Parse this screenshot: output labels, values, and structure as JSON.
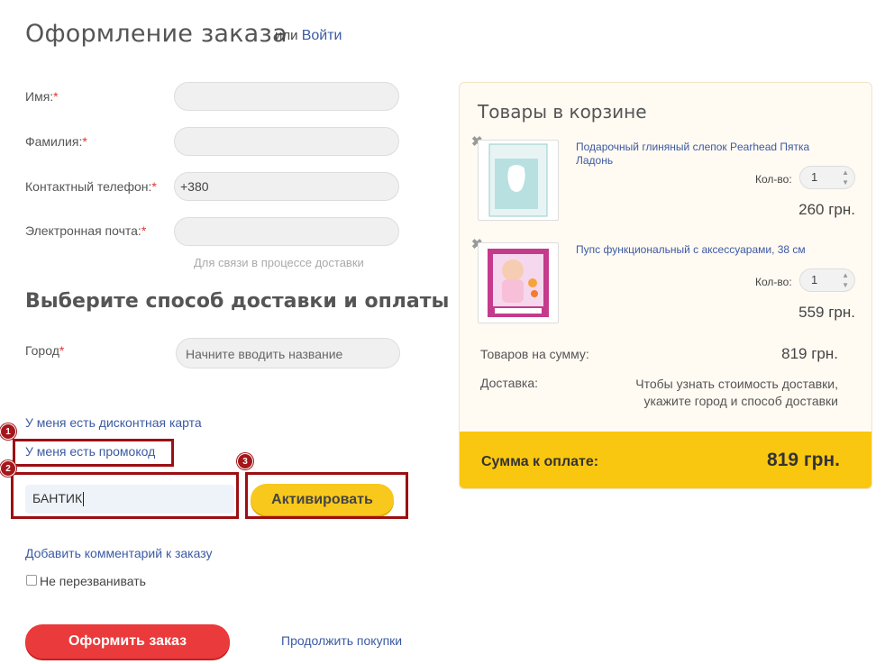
{
  "header": {
    "title": "Оформление заказа",
    "or_text": "или",
    "login_link": "Войти"
  },
  "contact_form": {
    "name_label": "Имя:",
    "lastname_label": "Фамилия:",
    "phone_label": "Контактный телефон:",
    "phone_value": "+380",
    "email_label": "Электронная почта:",
    "email_hint": "Для связи в процессе доставки",
    "required_mark": "*"
  },
  "delivery": {
    "section_title": "Выберите способ доставки и оплаты",
    "city_label": "Город",
    "city_placeholder": "Начните вводить название"
  },
  "discount": {
    "card_link": "У меня есть дисконтная карта",
    "promo_link": "У меня есть промокод",
    "promo_value": "БАНТИК",
    "activate_label": "Активировать"
  },
  "annotations": {
    "badge_1": "1",
    "badge_2": "2",
    "badge_3": "3"
  },
  "extras": {
    "comment_link": "Добавить комментарий к заказу",
    "no_call_label": "Не перезванивать"
  },
  "actions": {
    "submit_label": "Оформить заказ",
    "continue_label": "Продолжить покупки"
  },
  "cart": {
    "title": "Товары в корзине",
    "qty_label": "Кол-во:",
    "items": [
      {
        "name": "Подарочный глиняный слепок Pearhead Пятка Ладонь",
        "qty": "1",
        "price": "260 грн."
      },
      {
        "name": "Пупс функциональный с аксессуарами, 38 см",
        "qty": "1",
        "price": "559 грн."
      }
    ],
    "subtotal_label": "Товаров на сумму:",
    "subtotal_value": "819 грн.",
    "delivery_label": "Доставка:",
    "delivery_note_line1": "Чтобы узнать стоимость доставки,",
    "delivery_note_line2": "укажите город и способ доставки",
    "total_label": "Сумма к оплате:",
    "total_value": "819 грн."
  },
  "colors": {
    "accent_red": "#ea3a3b",
    "accent_yellow": "#fac710",
    "link_blue": "#3b5aa3",
    "annotation_red": "#9b0f13"
  }
}
